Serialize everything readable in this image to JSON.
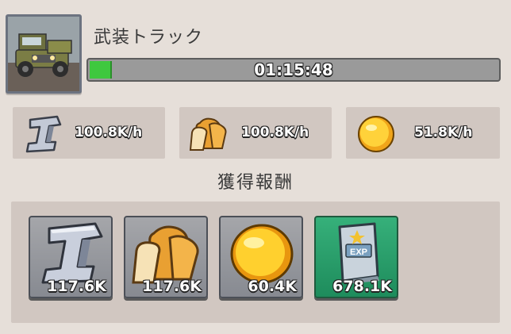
{
  "header": {
    "unit_name": "武装トラック",
    "timer": "01:15:48",
    "progress": 0.05
  },
  "rates": [
    {
      "resource": "iron",
      "icon": "iron-ingot-icon",
      "value": "100.8K/h"
    },
    {
      "resource": "bread",
      "icon": "bread-icon",
      "value": "100.8K/h"
    },
    {
      "resource": "coin",
      "icon": "gold-coin-icon",
      "value": "51.8K/h"
    }
  ],
  "rewards": {
    "title": "獲得報酬",
    "items": [
      {
        "resource": "iron",
        "icon": "iron-ingot-icon",
        "amount": "117.6K"
      },
      {
        "resource": "bread",
        "icon": "bread-icon",
        "amount": "117.6K"
      },
      {
        "resource": "coin",
        "icon": "gold-coin-icon",
        "amount": "60.4K"
      },
      {
        "resource": "exp",
        "icon": "exp-book-icon",
        "amount": "678.1K"
      }
    ]
  },
  "colors": {
    "progress_fill": "#3fc83f",
    "exp_card": "#2a9f6c",
    "panel": "#d1c7c1"
  }
}
